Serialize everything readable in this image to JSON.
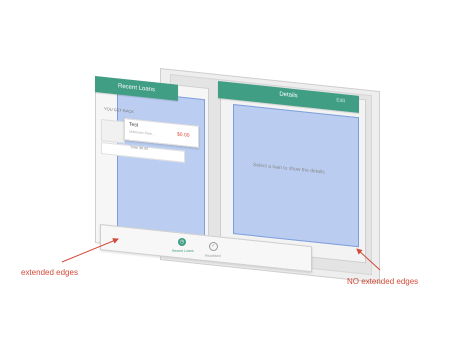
{
  "left_panel": {
    "header_title": "Recent Loans",
    "section_label": "YOU GET BACK",
    "loan": {
      "name": "Test",
      "subtitle": "Unknown Pers...",
      "amount": "$0.00"
    },
    "total_label": "Total: $0.00"
  },
  "right_panel": {
    "header_title": "Details",
    "edit_label": "Edit",
    "placeholder": "Select a loan to show the details"
  },
  "tabbar": {
    "tabs": [
      {
        "label": "Recent Loans",
        "icon": "clock-icon",
        "active": true
      },
      {
        "label": "Prioritised",
        "icon": "checkmark-icon",
        "active": false
      }
    ]
  },
  "annotations": {
    "left": "extended edges",
    "right": "NO extended edges"
  },
  "colors": {
    "brand_green": "#3f9e84",
    "highlight_blue": "#a7c0f0",
    "annotation_red": "#d24b3a",
    "amount_red": "#d9463a"
  }
}
